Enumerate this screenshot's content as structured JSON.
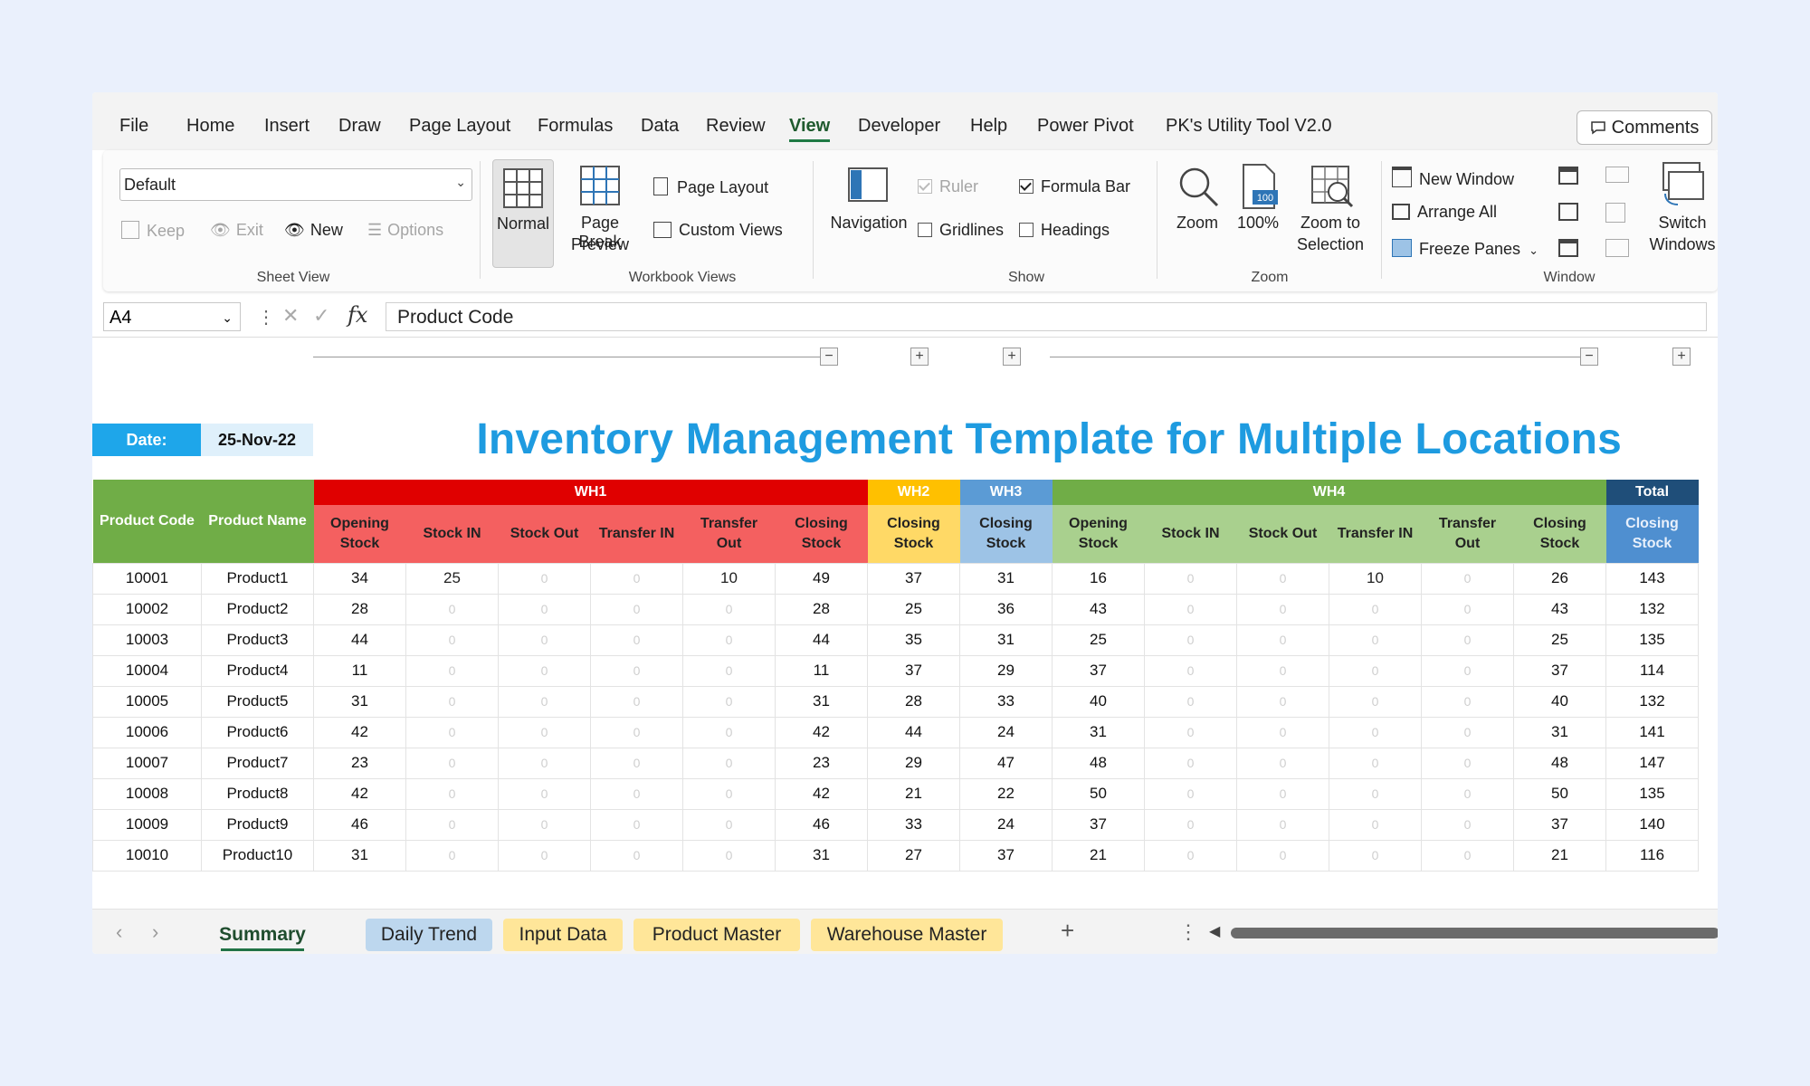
{
  "menu": {
    "items": [
      "File",
      "Home",
      "Insert",
      "Draw",
      "Page Layout",
      "Formulas",
      "Data",
      "Review",
      "View",
      "Developer",
      "Help",
      "Power Pivot",
      "PK's Utility Tool V2.0"
    ],
    "active": "View",
    "comments_label": "Comments"
  },
  "ribbon": {
    "sheet_view": {
      "dropdown_value": "Default",
      "keep": "Keep",
      "exit": "Exit",
      "new": "New",
      "options": "Options",
      "label": "Sheet View"
    },
    "workbook_views": {
      "normal": "Normal",
      "page_break_1": "Page Break",
      "page_break_2": "Preview",
      "page_layout": "Page Layout",
      "custom_views": "Custom Views",
      "label": "Workbook Views"
    },
    "show": {
      "navigation": "Navigation",
      "ruler": "Ruler",
      "formula_bar": "Formula Bar",
      "gridlines": "Gridlines",
      "headings": "Headings",
      "label": "Show"
    },
    "zoom": {
      "zoom": "Zoom",
      "hundred": "100%",
      "hundred_icon_text": "100",
      "zoom_to_1": "Zoom to",
      "zoom_to_2": "Selection",
      "label": "Zoom"
    },
    "window": {
      "new_window": "New Window",
      "arrange_all": "Arrange All",
      "freeze_panes": "Freeze Panes",
      "switch_1": "Switch",
      "switch_2": "Windows",
      "label": "Window"
    }
  },
  "formula_bar": {
    "cell_ref": "A4",
    "fx": "fx",
    "content": "Product Code"
  },
  "sheet": {
    "date_label": "Date:",
    "date_value": "25-Nov-22",
    "title": "Inventory Management Template for Multiple Locations",
    "headers": {
      "product_code": "Product Code",
      "product_name": "Product Name",
      "wh1": "WH1",
      "wh2": "WH2",
      "wh3": "WH3",
      "wh4": "WH4",
      "total": "Total",
      "opening_1": "Opening",
      "opening_2": "Stock",
      "stock_in": "Stock IN",
      "stock_out": "Stock Out",
      "transfer_in": "Transfer IN",
      "transfer_out_1": "Transfer",
      "transfer_out_2": "Out",
      "closing_1": "Closing",
      "closing_2": "Stock"
    },
    "rows": [
      [
        "10001",
        "Product1",
        "34",
        "25",
        "0",
        "0",
        "10",
        "49",
        "37",
        "31",
        "16",
        "0",
        "0",
        "10",
        "0",
        "26",
        "143"
      ],
      [
        "10002",
        "Product2",
        "28",
        "0",
        "0",
        "0",
        "0",
        "28",
        "25",
        "36",
        "43",
        "0",
        "0",
        "0",
        "0",
        "43",
        "132"
      ],
      [
        "10003",
        "Product3",
        "44",
        "0",
        "0",
        "0",
        "0",
        "44",
        "35",
        "31",
        "25",
        "0",
        "0",
        "0",
        "0",
        "25",
        "135"
      ],
      [
        "10004",
        "Product4",
        "11",
        "0",
        "0",
        "0",
        "0",
        "11",
        "37",
        "29",
        "37",
        "0",
        "0",
        "0",
        "0",
        "37",
        "114"
      ],
      [
        "10005",
        "Product5",
        "31",
        "0",
        "0",
        "0",
        "0",
        "31",
        "28",
        "33",
        "40",
        "0",
        "0",
        "0",
        "0",
        "40",
        "132"
      ],
      [
        "10006",
        "Product6",
        "42",
        "0",
        "0",
        "0",
        "0",
        "42",
        "44",
        "24",
        "31",
        "0",
        "0",
        "0",
        "0",
        "31",
        "141"
      ],
      [
        "10007",
        "Product7",
        "23",
        "0",
        "0",
        "0",
        "0",
        "23",
        "29",
        "47",
        "48",
        "0",
        "0",
        "0",
        "0",
        "48",
        "147"
      ],
      [
        "10008",
        "Product8",
        "42",
        "0",
        "0",
        "0",
        "0",
        "42",
        "21",
        "22",
        "50",
        "0",
        "0",
        "0",
        "0",
        "50",
        "135"
      ],
      [
        "10009",
        "Product9",
        "46",
        "0",
        "0",
        "0",
        "0",
        "46",
        "33",
        "24",
        "37",
        "0",
        "0",
        "0",
        "0",
        "37",
        "140"
      ],
      [
        "10010",
        "Product10",
        "31",
        "0",
        "0",
        "0",
        "0",
        "31",
        "27",
        "37",
        "21",
        "0",
        "0",
        "0",
        "0",
        "21",
        "116"
      ]
    ]
  },
  "tabs": {
    "summary": "Summary",
    "daily_trend": "Daily Trend",
    "input_data": "Input Data",
    "product_master": "Product Master",
    "warehouse_master": "Warehouse Master",
    "add": "+"
  },
  "colors": {
    "product_header": "#70ad47",
    "wh1_header": "#e00000",
    "wh1_sub": "#f46060",
    "wh2_header": "#ffc000",
    "wh2_sub": "#ffd966",
    "wh3_header": "#5b9bd5",
    "wh3_sub": "#9dc3e6",
    "wh4_header": "#70ad47",
    "wh4_sub": "#a9d08e",
    "total_header": "#1f4e79",
    "total_sub": "#4f8fd0",
    "date_label": "#1ea6ea",
    "title": "#1e9be0"
  }
}
